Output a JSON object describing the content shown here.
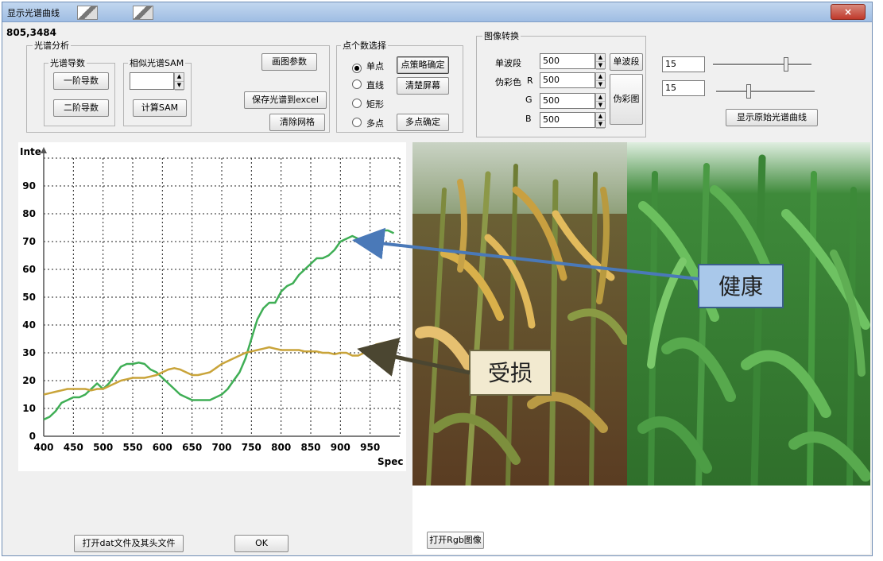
{
  "window": {
    "title": "显示光谱曲线",
    "close_label": "×"
  },
  "coords": "805,3484",
  "spectral_analysis": {
    "group_label": "光谱分析",
    "derivative": {
      "group_label": "光谱导数",
      "first": "一阶导数",
      "second": "二阶导数"
    },
    "sam": {
      "group_label": "相似光谱SAM",
      "compute": "计算SAM",
      "value": ""
    },
    "plot_params": "画图参数",
    "save_excel": "保存光谱到excel",
    "clear_grid": "清除网格"
  },
  "point_select": {
    "group_label": "点个数选择",
    "options": [
      "单点",
      "直线",
      "矩形",
      "多点"
    ],
    "selected": "单点",
    "confirm_points": "点策略确定",
    "clear_screen": "清楚屏幕",
    "multi_confirm": "多点确定"
  },
  "image_convert": {
    "group_label": "图像转换",
    "single_band_label": "单波段",
    "pseudo_color_label": "伪彩色",
    "r_label": "R",
    "g_label": "G",
    "b_label": "B",
    "single_band_value": "500",
    "r_value": "500",
    "g_value": "500",
    "b_value": "500",
    "single_band_button": "单波段",
    "pseudo_button": "伪彩图"
  },
  "sliders": {
    "value1": "15",
    "value2": "15",
    "pos1": 0.74,
    "pos2": 0.33,
    "show_original": "显示原始光谱曲线"
  },
  "bottom": {
    "open_dat": "打开dat文件及其头文件",
    "ok": "OK",
    "open_rgb": "打开Rgb图像"
  },
  "photo": {
    "healthy_label": "健康",
    "damaged_label": "受损"
  },
  "colors": {
    "healthy_series": "#3fae55",
    "damaged_series": "#c9a43a",
    "arrow_blue": "#4a79b8",
    "arrow_dark": "#4b4631"
  },
  "chart_data": {
    "type": "line",
    "ylabel": "Inte",
    "xlabel": "Spec",
    "xlim": [
      400,
      1000
    ],
    "ylim": [
      0,
      100
    ],
    "xticks": [
      400,
      450,
      500,
      550,
      600,
      650,
      700,
      750,
      800,
      850,
      900,
      950
    ],
    "yticks": [
      0,
      10,
      20,
      30,
      40,
      50,
      60,
      70,
      80,
      90
    ],
    "grid": true,
    "series": [
      {
        "color": "#3fae55",
        "x": [
          400,
          410,
          420,
          430,
          440,
          450,
          460,
          470,
          480,
          490,
          500,
          510,
          520,
          530,
          540,
          550,
          560,
          570,
          580,
          590,
          600,
          610,
          620,
          630,
          640,
          650,
          660,
          670,
          680,
          690,
          700,
          710,
          720,
          730,
          740,
          750,
          760,
          770,
          780,
          790,
          800,
          810,
          820,
          830,
          840,
          850,
          860,
          870,
          880,
          890,
          900,
          910,
          920,
          930,
          940,
          950,
          960,
          970,
          980,
          990
        ],
        "y": [
          6,
          7,
          9,
          12,
          13,
          14,
          14,
          15,
          17,
          19,
          17,
          19,
          22,
          25,
          26,
          26,
          26.5,
          26,
          24,
          23,
          21,
          19,
          17,
          15,
          14,
          13,
          13,
          13,
          13,
          14,
          15,
          17,
          20,
          23,
          28,
          35,
          42,
          46,
          48,
          48,
          52,
          54,
          55,
          58,
          60,
          62,
          64,
          64,
          65,
          67,
          70,
          71,
          72,
          71,
          71,
          72,
          73,
          74,
          74,
          73
        ]
      },
      {
        "color": "#c9a43a",
        "x": [
          400,
          410,
          420,
          430,
          440,
          450,
          460,
          470,
          480,
          490,
          500,
          510,
          520,
          530,
          540,
          550,
          560,
          570,
          580,
          590,
          600,
          610,
          620,
          630,
          640,
          650,
          660,
          670,
          680,
          690,
          700,
          710,
          720,
          730,
          740,
          750,
          760,
          770,
          780,
          790,
          800,
          810,
          820,
          830,
          840,
          850,
          860,
          870,
          880,
          890,
          900,
          910,
          920,
          930,
          940,
          950,
          960,
          970,
          980,
          990
        ],
        "y": [
          15,
          15.5,
          16,
          16.5,
          17,
          17,
          17,
          17,
          16.5,
          17,
          17,
          18,
          19,
          20,
          20.5,
          21,
          21,
          21,
          21.5,
          22,
          23,
          24,
          24.5,
          24,
          23,
          22,
          22,
          22.5,
          23,
          24.5,
          26,
          27,
          28,
          29,
          30,
          30.5,
          31,
          31.5,
          32,
          31.5,
          31,
          31,
          31,
          31,
          30.5,
          30.5,
          30.5,
          30,
          30,
          29.5,
          30,
          30,
          29,
          29,
          30,
          31,
          33,
          33.5,
          34,
          34
        ]
      }
    ]
  }
}
